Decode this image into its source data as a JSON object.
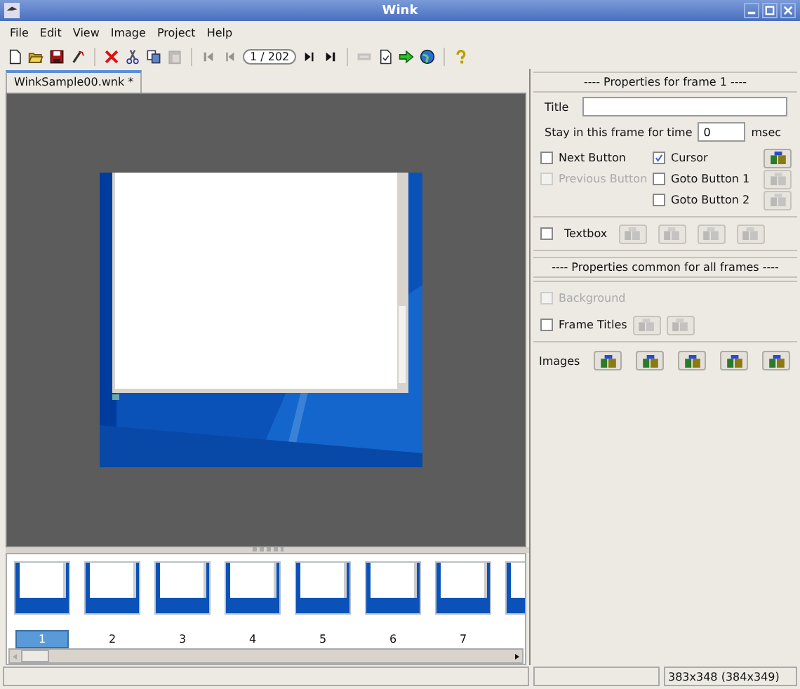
{
  "window": {
    "title": "Wink"
  },
  "menu": [
    "File",
    "Edit",
    "View",
    "Image",
    "Project",
    "Help"
  ],
  "toolbar": [
    {
      "kind": "new",
      "disabled": false
    },
    {
      "kind": "open",
      "disabled": false
    },
    {
      "kind": "save",
      "disabled": false
    },
    {
      "kind": "wand",
      "disabled": false
    },
    {
      "kind": "separator"
    },
    {
      "kind": "delete",
      "disabled": false
    },
    {
      "kind": "cut",
      "disabled": false
    },
    {
      "kind": "copy",
      "disabled": false
    },
    {
      "kind": "paste",
      "disabled": true
    },
    {
      "kind": "separator"
    },
    {
      "kind": "first",
      "disabled": true
    },
    {
      "kind": "prev",
      "disabled": true
    },
    {
      "kind": "counter",
      "text": "1 / 202"
    },
    {
      "kind": "next",
      "disabled": false
    },
    {
      "kind": "last",
      "disabled": false
    },
    {
      "kind": "separator"
    },
    {
      "kind": "render",
      "disabled": true
    },
    {
      "kind": "page",
      "disabled": false
    },
    {
      "kind": "arrow",
      "disabled": false
    },
    {
      "kind": "globe",
      "disabled": false
    },
    {
      "kind": "separator"
    },
    {
      "kind": "help",
      "disabled": false
    }
  ],
  "tabs": [
    {
      "label": "WinkSample00.wnk *",
      "selected": true
    }
  ],
  "thumbnails": {
    "items": [
      {
        "label": "1",
        "selected": true
      },
      {
        "label": "2",
        "selected": false
      },
      {
        "label": "3",
        "selected": false
      },
      {
        "label": "4",
        "selected": false
      },
      {
        "label": "5",
        "selected": false
      },
      {
        "label": "6",
        "selected": false
      },
      {
        "label": "7",
        "selected": false
      }
    ]
  },
  "frame_props": {
    "heading": "---- Properties for frame 1 ----",
    "title_label": "Title",
    "time_label": "Stay in this frame for time",
    "time_value": "0",
    "time_unit": "msec",
    "left_options": [
      {
        "label": "Next Button",
        "checked": false,
        "disabled": false
      },
      {
        "label": "Previous Button",
        "checked": false,
        "disabled": true
      }
    ],
    "right_options": [
      {
        "label": "Cursor",
        "checked": true,
        "disabled": false,
        "tools": [
          {
            "disabled": false
          }
        ]
      },
      {
        "label": "Goto Button 1",
        "checked": false,
        "disabled": false,
        "tools": [
          {
            "disabled": true
          }
        ]
      },
      {
        "label": "Goto Button 2",
        "checked": false,
        "disabled": false,
        "tools": [
          {
            "disabled": true
          }
        ]
      }
    ],
    "textbox": {
      "label": "Textbox",
      "checked": false,
      "disabled": false,
      "tools": [
        {
          "disabled": true
        },
        {
          "disabled": true
        },
        {
          "disabled": true
        },
        {
          "disabled": true
        }
      ]
    }
  },
  "common_props": {
    "heading": "---- Properties common for all frames ----",
    "options": [
      {
        "label": "Background",
        "checked": false,
        "disabled": true
      },
      {
        "label": "Frame Titles",
        "checked": false,
        "disabled": false,
        "tools": [
          {
            "disabled": true
          },
          {
            "disabled": true
          }
        ]
      }
    ]
  },
  "images": {
    "label": "Images",
    "tools": [
      {
        "disabled": false
      },
      {
        "disabled": false
      },
      {
        "disabled": false
      },
      {
        "disabled": false
      },
      {
        "disabled": false
      }
    ]
  },
  "status_bar": {
    "text": "383x348 (384x349)"
  }
}
